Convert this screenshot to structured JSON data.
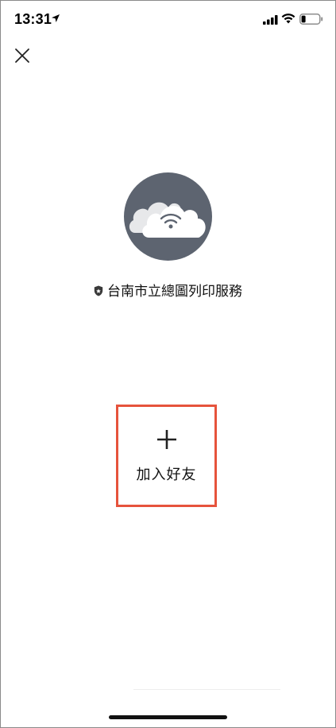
{
  "status_bar": {
    "time": "13:31",
    "icons": [
      "location-arrow-icon",
      "cellular-signal-icon",
      "wifi-icon",
      "battery-icon"
    ],
    "battery_level": 0.2
  },
  "header": {
    "close_icon": "close-icon"
  },
  "account": {
    "avatar_icon": "cloud-wifi-icon",
    "badge_icon": "shield-icon",
    "name": "台南市立總圖列印服務"
  },
  "actions": {
    "add_friend_icon": "plus-icon",
    "add_friend_label": "加入好友"
  },
  "colors": {
    "avatar_bg": "#5d6470",
    "highlight_border": "#e6533c",
    "text": "#111111"
  }
}
